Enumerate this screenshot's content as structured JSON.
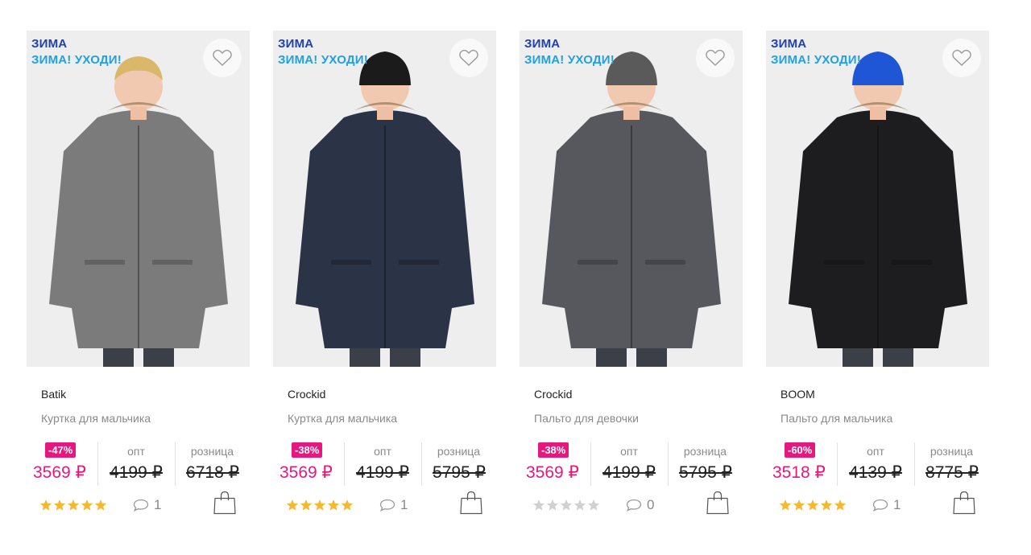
{
  "products": [
    {
      "season_tag": "ЗИМА",
      "promo_tag": "ЗИМА! УХОДИ!",
      "brand": "Batik",
      "title": "Куртка для мальчика",
      "discount": "-47%",
      "price": "3569 ₽",
      "opt_label": "опт",
      "opt_price": "4199 ₽",
      "retail_label": "розница",
      "retail_price": "6718 ₽",
      "rating": 5,
      "comments": "1",
      "jacket_color": "#7b7b7b",
      "hat_color": ""
    },
    {
      "season_tag": "ЗИМА",
      "promo_tag": "ЗИМА! УХОДИ!",
      "brand": "Crockid",
      "title": "Куртка для мальчика",
      "discount": "-38%",
      "price": "3569 ₽",
      "opt_label": "опт",
      "opt_price": "4199 ₽",
      "retail_label": "розница",
      "retail_price": "5795 ₽",
      "rating": 5,
      "comments": "1",
      "jacket_color": "#2b3347",
      "hat_color": "#1b1b1b"
    },
    {
      "season_tag": "ЗИМА",
      "promo_tag": "ЗИМА! УХОДИ!",
      "brand": "Crockid",
      "title": "Пальто для девочки",
      "discount": "-38%",
      "price": "3569 ₽",
      "opt_label": "опт",
      "opt_price": "4199 ₽",
      "retail_label": "розница",
      "retail_price": "5795 ₽",
      "rating": 0,
      "comments": "0",
      "jacket_color": "#57585d",
      "hat_color": "#5a5a5a"
    },
    {
      "season_tag": "ЗИМА",
      "promo_tag": "ЗИМА! УХОДИ!",
      "brand": "BOOM",
      "title": "Пальто для мальчика",
      "discount": "-60%",
      "price": "3518 ₽",
      "opt_label": "опт",
      "opt_price": "4139 ₽",
      "retail_label": "розница",
      "retail_price": "8775 ₽",
      "rating": 5,
      "comments": "1",
      "jacket_color": "#1d1d1f",
      "hat_color": "#1e56d6"
    }
  ],
  "colors": {
    "discount_pink": "#e5197d",
    "season_blue": "#1f3fb4",
    "promo_blue": "#1ea1e8",
    "star_filled": "#f5b82e",
    "star_empty": "#d0d0d0"
  },
  "icons": {
    "favorite": "heart-outline-icon",
    "comments": "speech-bubble-icon",
    "cart": "shopping-bag-icon",
    "rating": "star-icon"
  }
}
